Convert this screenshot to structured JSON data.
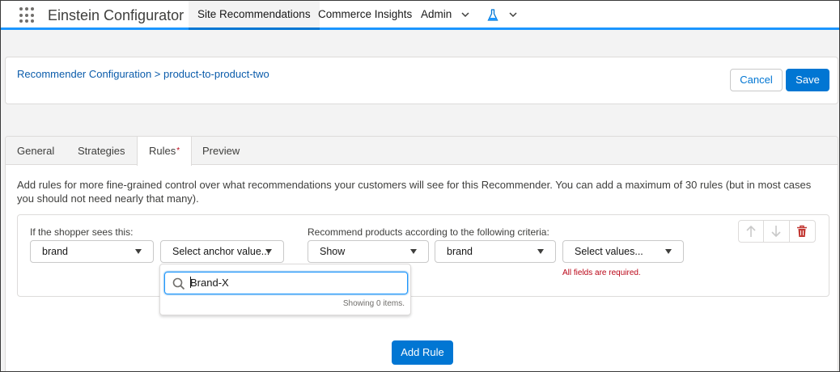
{
  "app": {
    "name": "Einstein Configurator"
  },
  "nav": {
    "tabs": [
      {
        "label": "Site Recommendations",
        "active": true
      },
      {
        "label": "Commerce Insights",
        "active": false
      },
      {
        "label": "Admin",
        "active": false
      }
    ],
    "icons": [
      "waffle-icon",
      "chevron-down-icon",
      "flask-icon",
      "chevron-down-icon"
    ]
  },
  "header": {
    "breadcrumb": "Recommender Configuration > product-to-product-two",
    "cancel_label": "Cancel",
    "save_label": "Save"
  },
  "tabs": [
    {
      "label": "General",
      "active": false
    },
    {
      "label": "Strategies",
      "active": false
    },
    {
      "label": "Rules",
      "active": true,
      "required_marker": "*"
    },
    {
      "label": "Preview",
      "active": false
    }
  ],
  "rules": {
    "description": "Add rules for more fine-grained control over what recommendations your customers will see for this Recommender. You can add a maximum of 30 rules (but in most cases you should not need nearly that many).",
    "shopper_label": "If the shopper sees this:",
    "criteria_label": "Recommend products according to the following criteria:",
    "shopper_attribute": "brand",
    "anchor_value_placeholder": "Select anchor value...",
    "action": "Show",
    "criteria_attribute": "brand",
    "values_placeholder": "Select values...",
    "error": "All fields are required.",
    "add_rule_label": "Add Rule"
  },
  "dropdown": {
    "search_value": "Brand-X",
    "status": "Showing 0 items."
  },
  "colors": {
    "brand": "#0176d3",
    "error": "#ba0517",
    "nav_accent": "#1b96ff"
  }
}
